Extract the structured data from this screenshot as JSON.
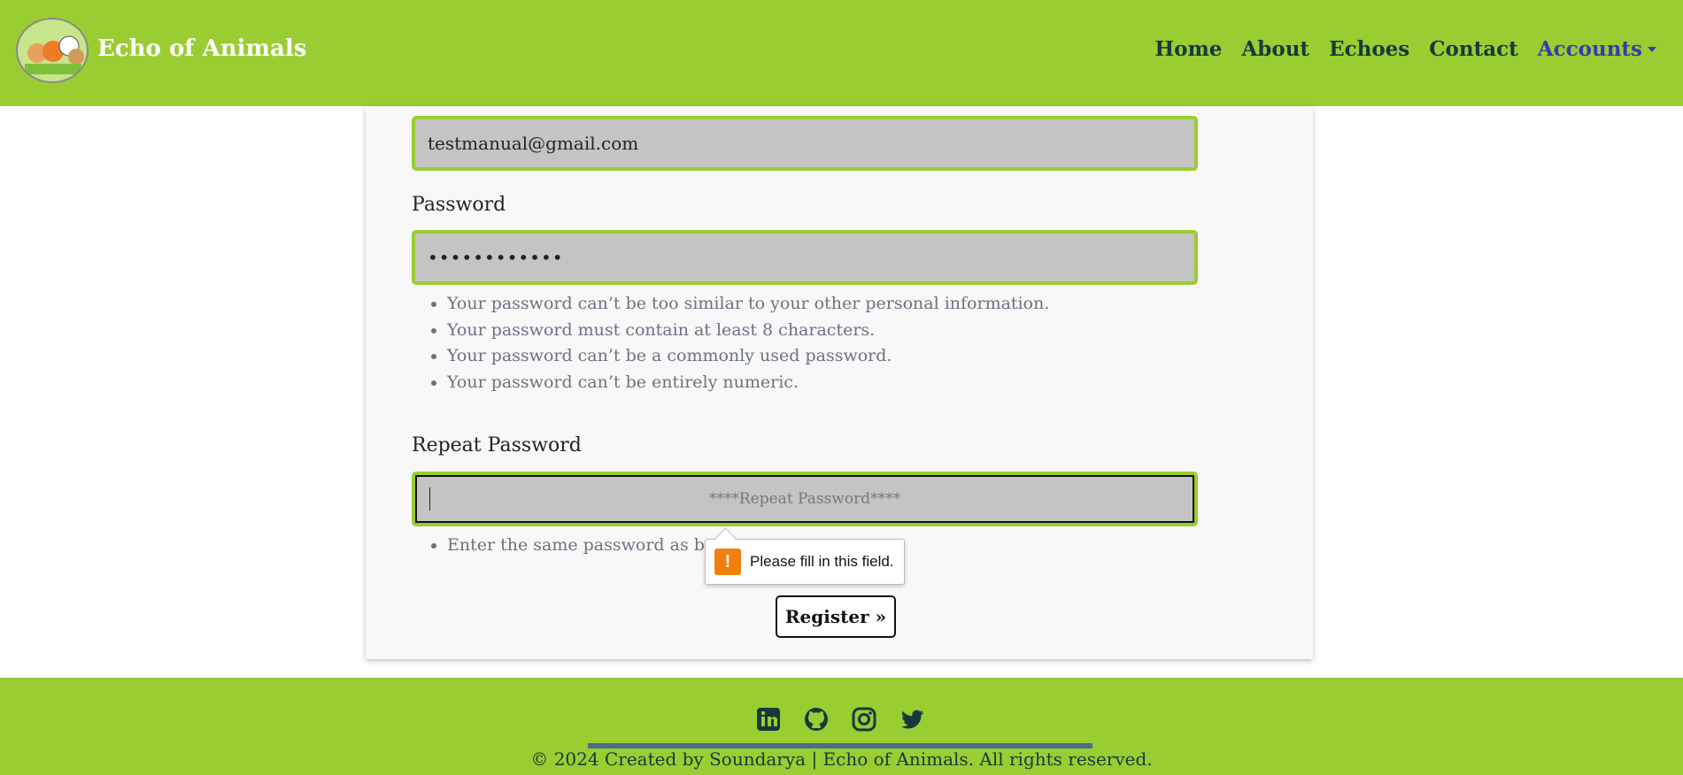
{
  "brand": {
    "name": "Echo of Animals",
    "logo_icon": "animals-logo-icon"
  },
  "nav": {
    "items": [
      {
        "label": "Home"
      },
      {
        "label": "About"
      },
      {
        "label": "Echoes"
      },
      {
        "label": "Contact"
      }
    ],
    "accounts_label": "Accounts"
  },
  "form": {
    "email_value": "testmanual@gmail.com",
    "password_label": "Password",
    "password_value": "••••••••••••",
    "password_hints": [
      "Your password can’t be too similar to your other personal information.",
      "Your password must contain at least 8 characters.",
      "Your password can’t be a commonly used password.",
      "Your password can’t be entirely numeric."
    ],
    "repeat_label": "Repeat Password",
    "repeat_placeholder": "****Repeat Password****",
    "repeat_hint": "Enter the same password as before",
    "register_label": "Register »"
  },
  "tooltip": {
    "message": "Please fill in this field.",
    "icon": "!"
  },
  "footer": {
    "social_icons": [
      "linkedin-icon",
      "github-icon",
      "instagram-icon",
      "twitter-icon"
    ],
    "copyright": "© 2024 Created by Soundarya | Echo of Animals. All rights reserved."
  },
  "colors": {
    "accent_green": "#9acd32",
    "nav_text": "#163a3a",
    "accounts": "#3a3aaa"
  }
}
